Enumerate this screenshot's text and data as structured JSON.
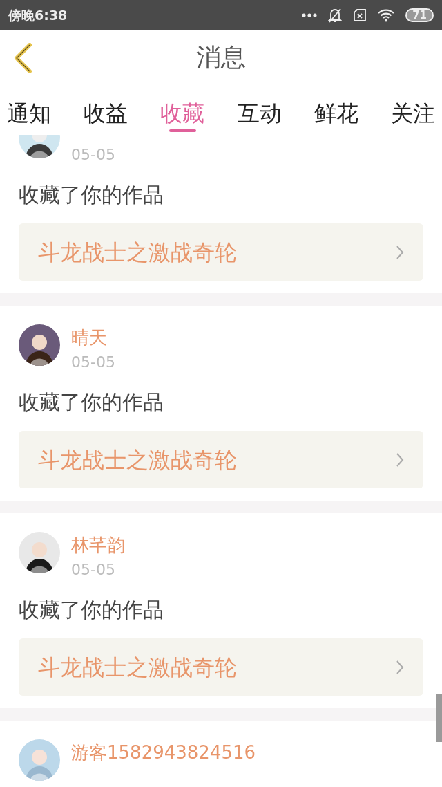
{
  "status_bar": {
    "time": "傍晚6:38",
    "battery": "71"
  },
  "header": {
    "title": "消息"
  },
  "tabs": [
    {
      "label": "通知",
      "selected": false
    },
    {
      "label": "收益",
      "selected": false
    },
    {
      "label": "收藏",
      "selected": true
    },
    {
      "label": "互动",
      "selected": false
    },
    {
      "label": "鲜花",
      "selected": false
    },
    {
      "label": "关注",
      "selected": false
    }
  ],
  "messages": [
    {
      "date": "05-05",
      "action": "收藏了你的作品",
      "work": "斗龙战士之激战奇轮"
    },
    {
      "name": "晴天",
      "date": "05-05",
      "action": "收藏了你的作品",
      "work": "斗龙战士之激战奇轮"
    },
    {
      "name": "林芊韵",
      "date": "05-05",
      "action": "收藏了你的作品",
      "work": "斗龙战士之激战奇轮"
    },
    {
      "name": "游客1582943824516"
    }
  ]
}
